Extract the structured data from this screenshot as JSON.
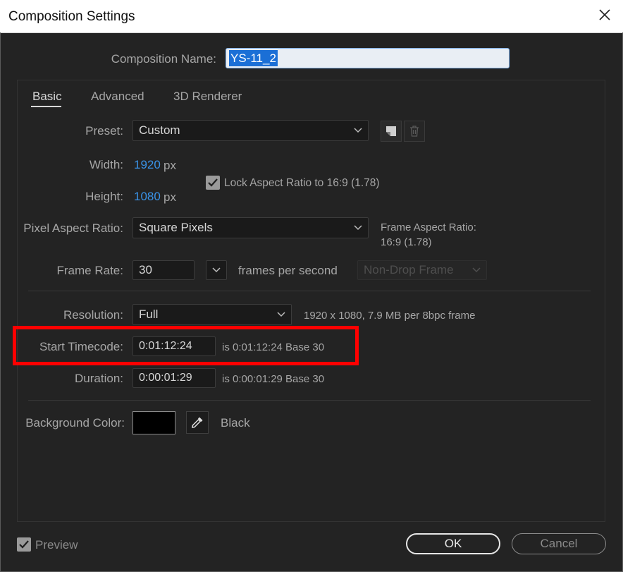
{
  "window": {
    "title": "Composition Settings"
  },
  "composition_name": {
    "label": "Composition Name:",
    "value": "YS-11_2"
  },
  "tabs": [
    {
      "label": "Basic",
      "active": true
    },
    {
      "label": "Advanced",
      "active": false
    },
    {
      "label": "3D Renderer",
      "active": false
    }
  ],
  "preset": {
    "label": "Preset:",
    "value": "Custom"
  },
  "width": {
    "label": "Width:",
    "value": "1920",
    "unit": "px"
  },
  "height": {
    "label": "Height:",
    "value": "1080",
    "unit": "px"
  },
  "lock_aspect": {
    "label": "Lock Aspect Ratio to 16:9 (1.78)",
    "checked": true
  },
  "pixel_aspect": {
    "label": "Pixel Aspect Ratio:",
    "value": "Square Pixels"
  },
  "frame_aspect": {
    "label": "Frame Aspect Ratio:",
    "value": "16:9 (1.78)"
  },
  "frame_rate": {
    "label": "Frame Rate:",
    "value": "30",
    "unit": "frames per second",
    "drop_frame": "Non-Drop Frame"
  },
  "resolution": {
    "label": "Resolution:",
    "value": "Full",
    "info": "1920 x 1080, 7.9 MB per 8bpc frame"
  },
  "start_timecode": {
    "label": "Start Timecode:",
    "value": "0:01:12:24",
    "info": "is 0:01:12:24",
    "base": "Base 30"
  },
  "duration": {
    "label": "Duration:",
    "value": "0:00:01:29",
    "info": "is 0:00:01:29",
    "base": "Base 30"
  },
  "background_color": {
    "label": "Background Color:",
    "swatch": "#000000",
    "name": "Black"
  },
  "preview": {
    "label": "Preview",
    "checked": true
  },
  "buttons": {
    "ok": "OK",
    "cancel": "Cancel"
  },
  "colors": {
    "accent_blue": "#3a93e8",
    "highlight_red": "#ff0000",
    "dialog_bg": "#232323"
  }
}
